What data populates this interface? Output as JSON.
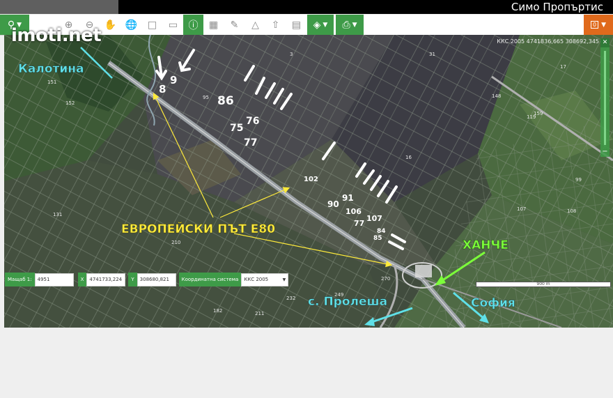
{
  "header": {
    "owner": "Симо Пропъртис",
    "logo": "imoti.net"
  },
  "toolbar": {
    "icons": [
      "search-icon",
      "zoom-in-icon",
      "zoom-out-icon",
      "hand-icon",
      "globe-icon",
      "rect-select-icon",
      "rect-icon",
      "info-icon",
      "layers-table-icon",
      "ruler-icon",
      "area-icon",
      "upload-icon",
      "select-icon",
      "layers-icon",
      "print-icon"
    ],
    "right_badge": "0"
  },
  "map": {
    "crs_readout": "ККС 2005 4741836,665 308692,345",
    "scale_label": "900 m",
    "annotations": {
      "kalotina": "Калотина",
      "e80": "ЕВРОПЕЙСКИ ПЪТ Е80",
      "hanche": "ХАНЧЕ",
      "prolesha": "с. Пролеша",
      "sofia": "София"
    },
    "parcel_labels": [
      "8",
      "9",
      "86",
      "76",
      "75",
      "77",
      "102",
      "91",
      "90",
      "106",
      "107",
      "77",
      "84",
      "85"
    ],
    "map_numbers": [
      "151",
      "152",
      "3",
      "31",
      "159",
      "16",
      "95",
      "17",
      "99",
      "107",
      "108",
      "119",
      "148",
      "182",
      "211",
      "249",
      "270",
      "131",
      "210",
      "232"
    ]
  },
  "coords_bar": {
    "scale_label": "Мащаб 1:",
    "scale_value": "4951",
    "x_label": "X",
    "x_value": "4741733,224",
    "y_label": "Y",
    "y_value": "308680,821",
    "crs_label": "Координатна система",
    "crs_value": "ККС 2005"
  },
  "colors": {
    "accent_green": "#3e9b48",
    "accent_orange": "#e06a1c",
    "label_yellow": "#ffeb3b",
    "label_cyan": "#5fe0e8",
    "label_green": "#7cff3a"
  }
}
